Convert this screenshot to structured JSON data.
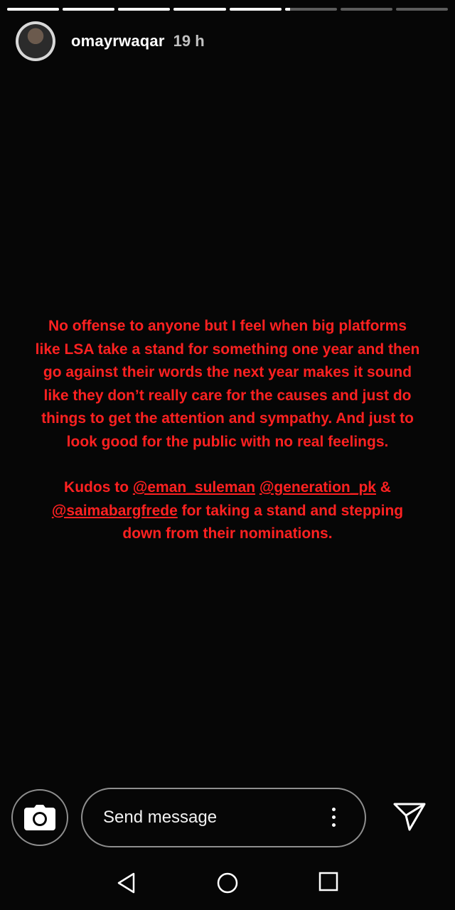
{
  "story": {
    "progress": [
      1,
      1,
      1,
      1,
      1,
      0.1,
      0,
      0
    ],
    "username": "omayrwaqar",
    "time": "19 h",
    "text_color": "#ff2121",
    "paragraph1": "No offense to anyone but I feel when big platforms\nlike LSA take a stand for something one year and then\ngo against their words the next year makes it sound\nlike they don’t really care for the causes and just do\nthings to get the attention and sympathy. And just to\nlook good for the public with no real feelings.",
    "kudos_prefix": "Kudos to ",
    "mention1": "@eman_suleman",
    "mention2": "@generation_pk",
    "amp": " &",
    "mention3": "@saimabargfrede",
    "kudos_suffix": " for taking a stand and stepping\ndown from their nominations."
  },
  "footer": {
    "camera_icon": "camera-icon",
    "message_placeholder": "Send message",
    "more_icon": "more-vertical-icon",
    "send_icon": "send-icon"
  },
  "navbar": {
    "back_icon": "back-triangle-icon",
    "home_icon": "home-circle-icon",
    "recents_icon": "recents-square-icon"
  }
}
